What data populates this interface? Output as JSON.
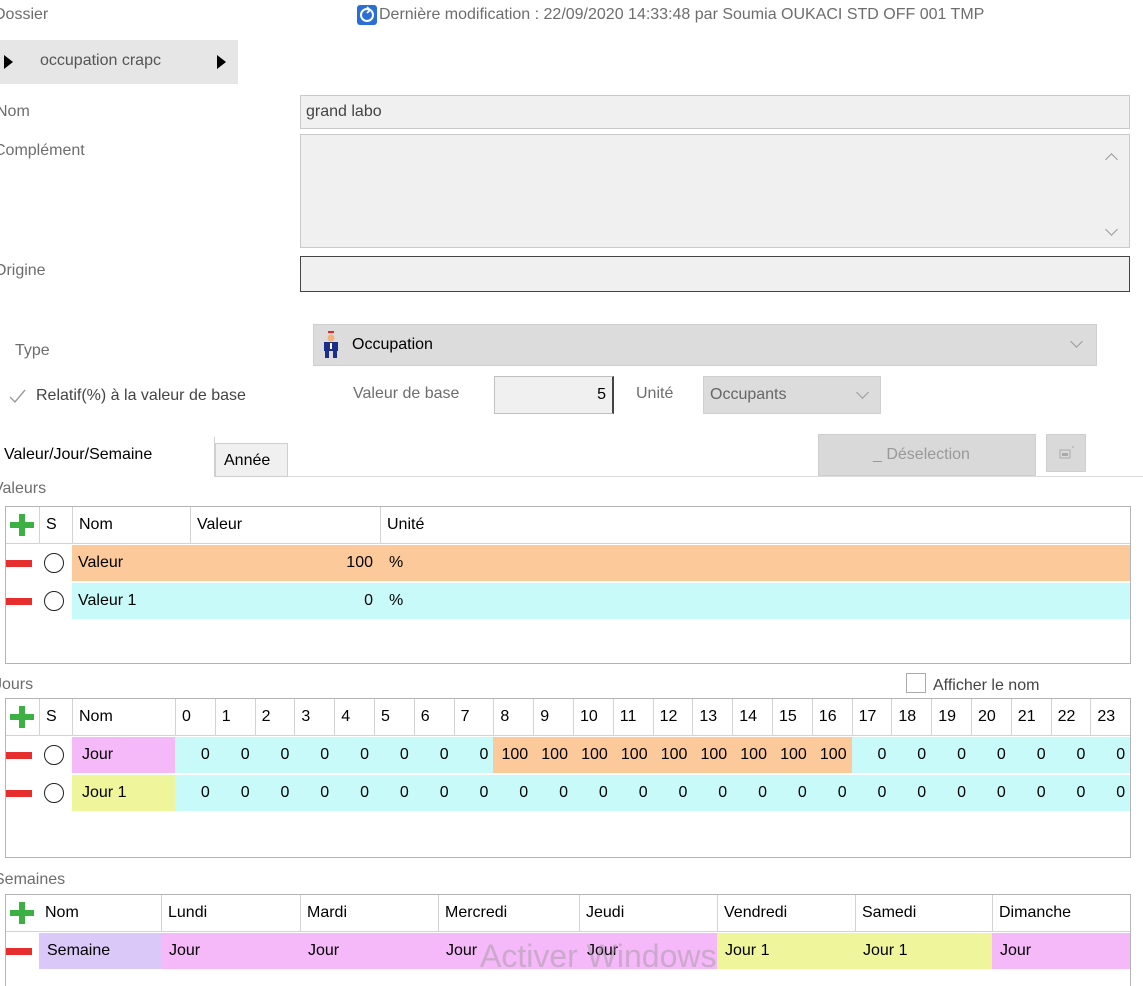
{
  "header": {
    "dossier_label": "Dossier",
    "modified": "Dernière modification : 22/09/2020 14:33:48 par Soumia OUKACI STD OFF 001 TMP",
    "breadcrumb": "occupation crapc"
  },
  "form": {
    "nom_label": "Nom",
    "nom_value": "grand labo",
    "complement_label": "Complément",
    "complement_value": "",
    "origine_label": "Origine",
    "origine_value": "",
    "type_label": "Type",
    "type_value": "Occupation",
    "relatif_label": "Relatif(%) à la valeur de base",
    "relatif_checked": true,
    "valeur_base_label": "Valeur de base",
    "valeur_base_value": "5",
    "unite_label": "Unité",
    "unite_value": "Occupants"
  },
  "tabs": [
    {
      "label": "Valeur/Jour/Semaine",
      "active": true
    },
    {
      "label": "Année",
      "active": false
    }
  ],
  "actions": {
    "deselect_label": "_ Déselection"
  },
  "valeurs": {
    "section_label": "Valeurs",
    "headers": {
      "s": "S",
      "nom": "Nom",
      "valeur": "Valeur",
      "unite": "Unité"
    },
    "rows": [
      {
        "nom": "Valeur",
        "valeur": "100",
        "unite": "%",
        "color": "#fcc99a"
      },
      {
        "nom": "Valeur 1",
        "valeur": "0",
        "unite": "%",
        "color": "#c8fafa"
      }
    ]
  },
  "jours": {
    "section_label": "Jours",
    "afficher_label": "Afficher le nom",
    "headers": {
      "s": "S",
      "nom": "Nom"
    },
    "hours": [
      "0",
      "1",
      "2",
      "3",
      "4",
      "5",
      "6",
      "7",
      "8",
      "9",
      "10",
      "11",
      "12",
      "13",
      "14",
      "15",
      "16",
      "17",
      "18",
      "19",
      "20",
      "21",
      "22",
      "23"
    ],
    "rows": [
      {
        "nom": "Jour",
        "color": "#f5b8f8",
        "values": [
          "0",
          "0",
          "0",
          "0",
          "0",
          "0",
          "0",
          "0",
          "100",
          "100",
          "100",
          "100",
          "100",
          "100",
          "100",
          "100",
          "100",
          "0",
          "0",
          "0",
          "0",
          "0",
          "0",
          "0"
        ]
      },
      {
        "nom": "Jour 1",
        "color": "#eef59a",
        "values": [
          "0",
          "0",
          "0",
          "0",
          "0",
          "0",
          "0",
          "0",
          "0",
          "0",
          "0",
          "0",
          "0",
          "0",
          "0",
          "0",
          "0",
          "0",
          "0",
          "0",
          "0",
          "0",
          "0",
          "0"
        ]
      }
    ]
  },
  "semaines": {
    "section_label": "Semaines",
    "headers": [
      "Nom",
      "Lundi",
      "Mardi",
      "Mercredi",
      "Jeudi",
      "Vendredi",
      "Samedi",
      "Dimanche"
    ],
    "rows": [
      {
        "cells": [
          "Semaine",
          "Jour",
          "Jour",
          "Jour",
          "Jour",
          "Jour 1",
          "Jour 1",
          "Jour"
        ]
      }
    ]
  },
  "watermark": "Activer Windows",
  "colors": {
    "valeur_orange": "#fcc99a",
    "cyan": "#c8fafa",
    "jour_pink": "#f5b8f8",
    "jour1_yellow": "#eef59a",
    "semaine_purple": "#d9c8f8",
    "plus_green": "#3cb043",
    "minus_red": "#e62e2e"
  }
}
